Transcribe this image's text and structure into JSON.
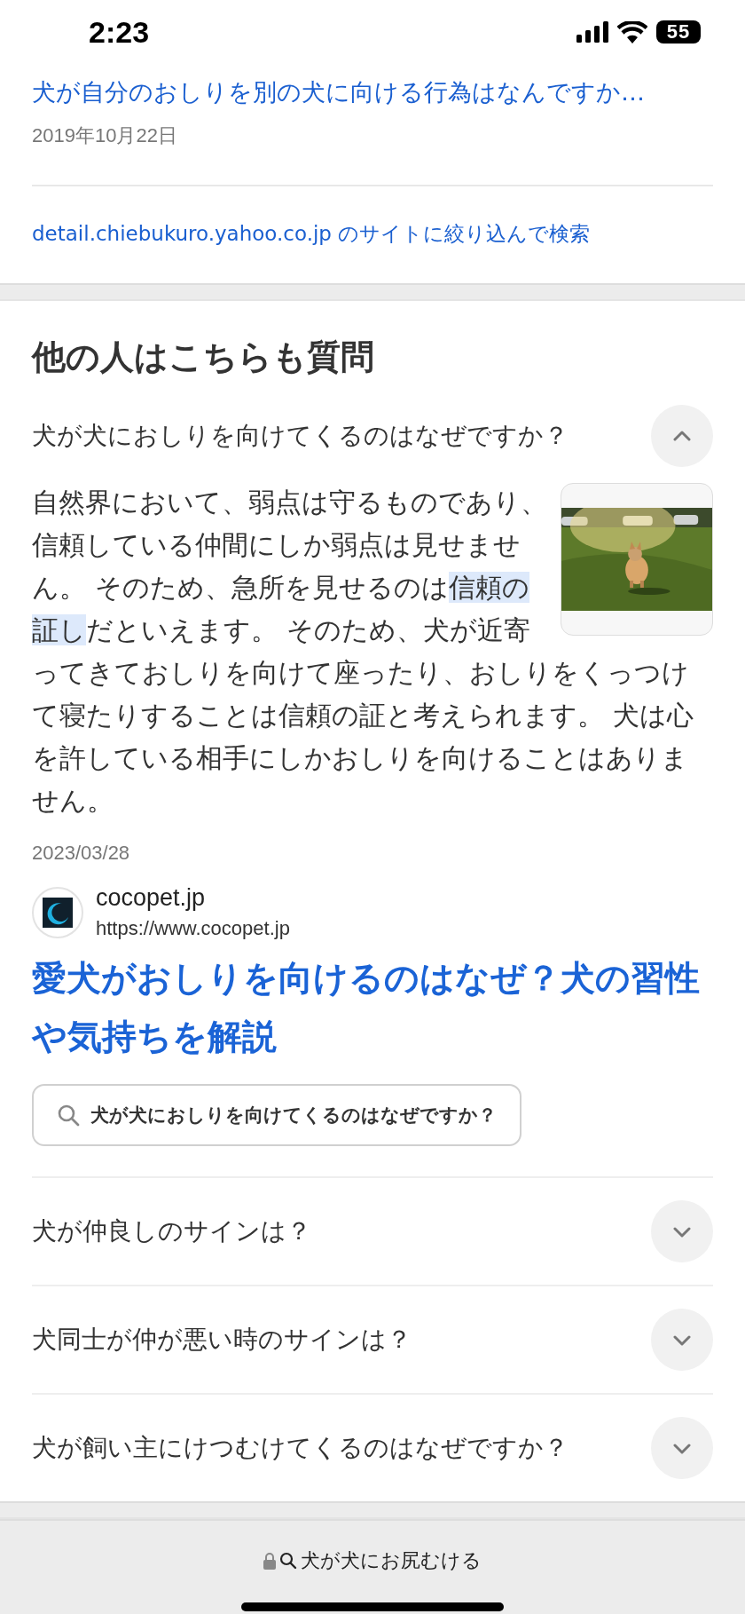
{
  "status_bar": {
    "time": "2:23",
    "battery": "55"
  },
  "previous_result": {
    "title": "犬が自分のおしりを別の犬に向ける行為はなんですか…",
    "date": "2019年10月22日"
  },
  "site_filter_link": "detail.chiebukuro.yahoo.co.jp のサイトに絞り込んで検索",
  "related_questions": {
    "heading": "他の人はこちらも質問",
    "items": [
      {
        "question": "犬が犬におしりを向けてくるのはなぜですか？",
        "expanded": true,
        "answer": {
          "text_before": "自然界において、弱点は守るものであり、信頼している仲間にしか弱点は見せません。 そのため、急所を見せるのは",
          "highlight": "信頼の証し",
          "text_after": "だといえます。 そのため、犬が近寄ってきておしりを向けて座ったり、おしりをくっつけて寝たりすることは信頼の証と考えられます。 犬は心を許している相手にしかおしりを向けることはありません。",
          "date": "2023/03/28",
          "source_name": "cocopet.jp",
          "source_url": "https://www.cocopet.jp",
          "headline": "愛犬がおしりを向けるのはなぜ？犬の習性や気持ちを解説",
          "search_chip": "犬が犬におしりを向けてくるのはなぜですか？"
        }
      },
      {
        "question": "犬が仲良しのサインは？",
        "expanded": false
      },
      {
        "question": "犬同士が仲が悪い時のサインは？",
        "expanded": false
      },
      {
        "question": "犬が飼い主にけつむけてくるのはなぜですか？",
        "expanded": false
      }
    ]
  },
  "address_bar": {
    "text": "犬が犬にお尻むける"
  }
}
